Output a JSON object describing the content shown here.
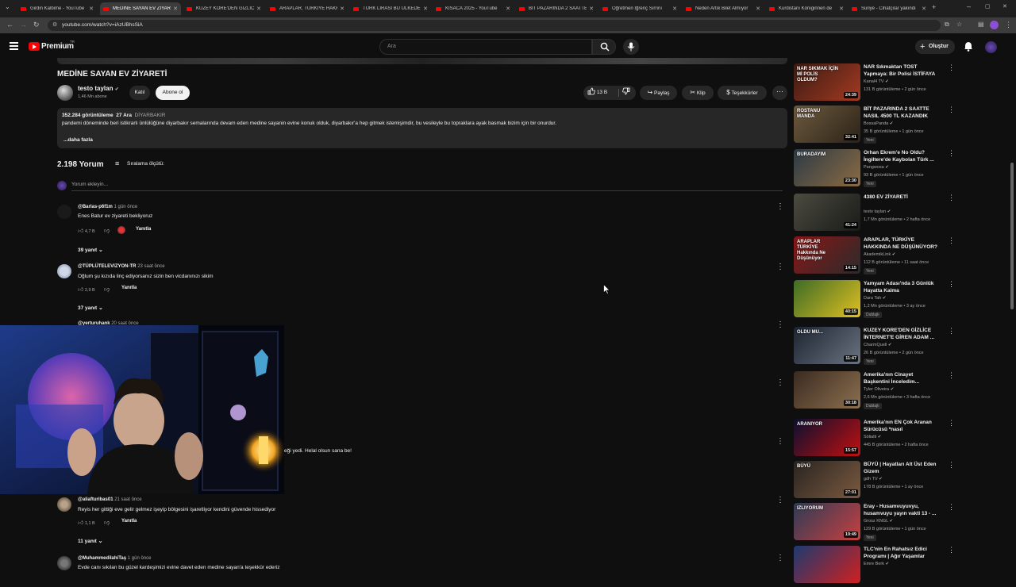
{
  "tabs": [
    {
      "title": "Girdin Kalbime - YouTube",
      "active": false
    },
    {
      "title": "MEDİNE SAYAN EV ZİYARETİ",
      "active": true
    },
    {
      "title": "KUZEY KORE'DEN GİZLİCE",
      "active": false
    },
    {
      "title": "ARAPLAR, TÜRKİYE HAKKI",
      "active": false
    },
    {
      "title": "TÜRK LİRASI BU ÜLKEDE",
      "active": false
    },
    {
      "title": "KISACA 2025 - YouTube",
      "active": false
    },
    {
      "title": "BİT PAZARINDA 2 SAATTE",
      "active": false
    },
    {
      "title": "Öğretmen İğrenç Sırrını",
      "active": false
    },
    {
      "title": "Neden Artık Bilet Almıyor",
      "active": false
    },
    {
      "title": "Kurdistanı Königinnen de",
      "active": false
    },
    {
      "title": "Suriye - Cihatçılar yakındı",
      "active": false
    }
  ],
  "browser": {
    "url": "youtube.com/watch?v=iAzUBhsSiA"
  },
  "header": {
    "logo": "Premium",
    "logo_sup": "TR",
    "search_placeholder": "Ara",
    "create_label": "Oluştur"
  },
  "video": {
    "title": "MEDİNE SAYAN EV ZİYARETİ",
    "channel": "testo taylan",
    "subscribers": "1,46 Mn abone",
    "join_label": "Katıl",
    "subscribe_label": "Abone ol",
    "likes": "13 B",
    "share_label": "Paylaş",
    "clip_label": "Klip",
    "thanks_label": "Teşekkürler"
  },
  "description": {
    "views": "352.284 görüntüleme",
    "date": "27 Ara",
    "tag": "DİYARBAKIR",
    "text": "pandemi döneminde beri istikrarlı ünlülüğüne diyarbakır semalarında devam eden medine sayanin evine konuk olduk, diyarbakır'a hep gitmek istemişimdir, bu vesileyle bu topraklara ayak basmak bizim için bir onurdur.",
    "more": "...daha fazla"
  },
  "comments_header": {
    "count": "2.198 Yorum",
    "sort_label": "Sıralama ölçütü:",
    "add_placeholder": "Yorum ekleyin..."
  },
  "comments": [
    {
      "author": "@Barlas-p6f1m",
      "time": "1 gün önce",
      "text": "Enes Batur ev ziyareti bekliyoruz",
      "likes": "4,7 B",
      "reply": "Yanıtla",
      "replies": "39 yanıt"
    },
    {
      "author": "@TÜPLÜTELEVIZYON-TR",
      "time": "23 saat önce",
      "text": "Oğlum şu kızıda linç ediyorsanız sizin ben vicdanınızı sikim",
      "likes": "2,9 B",
      "reply": "Yanıtla",
      "replies": "37 yanıt"
    },
    {
      "author": "@yerturuhank",
      "time": "20 saat önce",
      "text": "eği yedi. Helal olsun sana be!",
      "likes": "",
      "reply": "",
      "replies": ""
    },
    {
      "author": "@aliafturibas01",
      "time": "21 saat önce",
      "text": "Reyis her gittiği eve gelir gelmez işeyip bölgesini işaretliyor kendini güvende hissediyor",
      "likes": "1,1 B",
      "reply": "Yanıtla",
      "replies": "11 yanıt"
    },
    {
      "author": "@MuhammedilahiTaş",
      "time": "1 gün önce",
      "text": "Evde canı sıkılan bu güzel kardeşimizi evine davet eden medine sayan'a teşekkür ederiz",
      "likes": "",
      "reply": "",
      "replies": ""
    }
  ],
  "recommended": [
    {
      "title": "NAR Sıkmaktan TOST Yapmaya: Bir Polisi İSTİFAYA ...",
      "channel": "Kanal4 TV",
      "stats": "131 B görüntüleme • 2 gün önce",
      "duration": "24:39",
      "badge": "",
      "thumb_text": "NAR SIKMAK İÇİN Mİ POLİS OLDUM?"
    },
    {
      "title": "BİT PAZARINDA 2 SAATTE NASIL 4500 TL KAZANDIK #256",
      "channel": "BossaPanda",
      "stats": "35 B görüntüleme • 1 gün önce",
      "duration": "32:41",
      "badge": "Yeni",
      "thumb_text": "ROSTANU MANDA"
    },
    {
      "title": "Orhan Ekrem'e No Oldu? İngiltere'de Kaybolan Türk ...",
      "channel": "Pangwosa",
      "stats": "93 B görüntüleme • 1 gün önce",
      "duration": "23:30",
      "badge": "Yeni",
      "thumb_text": "BURADAYIM"
    },
    {
      "title": "4380 EV ZİYARETİ",
      "channel": "testo taylan",
      "stats": "1,7 Mn görüntüleme • 2 hafta önce",
      "duration": "41:24",
      "badge": "",
      "thumb_text": ""
    },
    {
      "title": "ARAPLAR, TÜRKİYE HAKKINDA NE DÜŞÜNÜYOR? | Suudi ...",
      "channel": "AkademikLink",
      "stats": "112 B görüntüleme • 11 saat önce",
      "duration": "14:15",
      "badge": "Yeni",
      "thumb_text": "ARAPLAR TÜRKİYE Hakkında Ne Düşünüyor"
    },
    {
      "title": "Yamyam Adası'nda 3 Günlük Hayatta Kalma",
      "channel": "Dara Tah",
      "stats": "1,2 Mn görüntüleme • 3 ay önce",
      "duration": "40:15",
      "badge": "Dublajlı",
      "thumb_text": ""
    },
    {
      "title": "KUZEY KORE'DEN GİZLİCE İNTERNET'E GİREN ADAM ...",
      "channel": "CharmQuell",
      "stats": "26 B görüntüleme • 2 gün önce",
      "duration": "11:47",
      "badge": "Yeni",
      "thumb_text": "OLDU MU..."
    },
    {
      "title": "Amerika'nın Cinayet Başkentini İnceledim...",
      "channel": "Tyler Oliveira",
      "stats": "2,6 Mn görüntüleme • 3 hafta önce",
      "duration": "30:18",
      "badge": "Dublajlı",
      "thumb_text": ""
    },
    {
      "title": "Amerika'nın EN Çok Aranan Sürücüsü *nasıl yakalanamıyor?*",
      "channel": "Sölialti",
      "stats": "445 B görüntüleme • 2 hafta önce",
      "duration": "15:57",
      "badge": "",
      "thumb_text": "ARANIYOR"
    },
    {
      "title": "BÜYÜ | Hayatları Alt Üst Eden Gizem",
      "channel": "gdh TV",
      "stats": "178 B görüntüleme • 1 ay önce",
      "duration": "27:01",
      "badge": "",
      "thumb_text": "BÜYÜ"
    },
    {
      "title": "Eray - Husamvuyuvyu, husamvuyu yayın vakti 13 - ...",
      "channel": "Grosz KNGL",
      "stats": "129 B görüntüleme • 1 gün önce",
      "duration": "19:49",
      "badge": "Yeni",
      "thumb_text": "IZLIYORUM"
    },
    {
      "title": "TLC'nin En Rahatsız Edici Programı | Ağır Yaşamlar",
      "channel": "Emre Berk",
      "stats": "",
      "duration": "",
      "badge": "",
      "thumb_text": ""
    }
  ],
  "colors": {
    "bg": "#0f0f0f",
    "accent": "#ff0000",
    "surface": "#272727"
  }
}
